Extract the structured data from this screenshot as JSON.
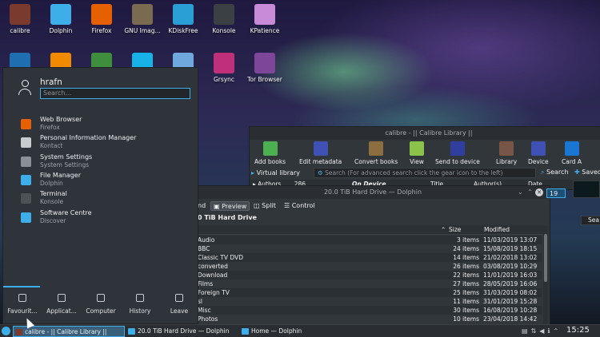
{
  "desktop_icons_row1": [
    {
      "label": "calibre",
      "icon": "calibre-icon",
      "color": "#7a3b2e"
    },
    {
      "label": "Dolphin",
      "icon": "folder-icon",
      "color": "#3daee9"
    },
    {
      "label": "Firefox",
      "icon": "firefox-icon",
      "color": "#e66000"
    },
    {
      "label": "GNU Imag...",
      "icon": "gimp-icon",
      "color": "#7a6a4f"
    },
    {
      "label": "KDiskFree",
      "icon": "disk-icon",
      "color": "#2a9fd6"
    },
    {
      "label": "Konsole",
      "icon": "terminal-icon",
      "color": "#3b4045"
    },
    {
      "label": "KPatience",
      "icon": "cards-icon",
      "color": "#c78bd8"
    }
  ],
  "desktop_icons_row2": [
    {
      "label": "",
      "icon": "virtualbox-icon",
      "color": "#1f6fb0"
    },
    {
      "label": "",
      "icon": "vlc-icon",
      "color": "#f08a00"
    },
    {
      "label": "",
      "icon": "keepass-icon",
      "color": "#3e8e3e"
    },
    {
      "label": "",
      "icon": "kodi-icon",
      "color": "#17b2e7"
    },
    {
      "label": "",
      "icon": "drop-icon",
      "color": "#6fa8dc"
    },
    {
      "label": "Grsync",
      "icon": "grsync-icon",
      "color": "#c0307a"
    },
    {
      "label": "Tor Browser",
      "icon": "tor-icon",
      "color": "#7d4698"
    }
  ],
  "launcher": {
    "user": "hrafn",
    "search_placeholder": "Search...",
    "apps": [
      {
        "name": "Web Browser",
        "sub": "Firefox",
        "color": "#e66000",
        "icon": "firefox-icon"
      },
      {
        "name": "Personal Information Manager",
        "sub": "Kontact",
        "color": "#c9ccce",
        "icon": "kontact-icon"
      },
      {
        "name": "System Settings",
        "sub": "System Settings",
        "color": "#8a9096",
        "icon": "settings-icon"
      },
      {
        "name": "File Manager",
        "sub": "Dolphin",
        "color": "#3daee9",
        "icon": "folder-icon"
      },
      {
        "name": "Terminal",
        "sub": "Konsole",
        "color": "#4d5257",
        "icon": "terminal-icon"
      },
      {
        "name": "Software Centre",
        "sub": "Discover",
        "color": "#3daee9",
        "icon": "discover-icon"
      }
    ],
    "tabs": [
      {
        "label": "Favourit...",
        "icon": "bookmark-icon"
      },
      {
        "label": "Applicat...",
        "icon": "grid-icon"
      },
      {
        "label": "Computer",
        "icon": "computer-icon"
      },
      {
        "label": "History",
        "icon": "clock-icon"
      },
      {
        "label": "Leave",
        "icon": "leave-icon"
      }
    ]
  },
  "calibre": {
    "title": "calibre - || Calibre Library ||",
    "toolbar": [
      {
        "label": "Add books",
        "color": "#4caf50",
        "icon": "add-books-icon"
      },
      {
        "label": "Edit metadata",
        "color": "#3f51b5",
        "icon": "edit-metadata-icon"
      },
      {
        "label": "Convert books",
        "color": "#8d6e3f",
        "icon": "convert-books-icon"
      },
      {
        "label": "View",
        "color": "#8bc34a",
        "icon": "view-icon"
      },
      {
        "label": "Send to device",
        "color": "#303f9f",
        "icon": "send-device-icon"
      },
      {
        "label": "Library",
        "color": "#795548",
        "icon": "library-icon"
      },
      {
        "label": "Device",
        "color": "#3f51b5",
        "icon": "device-icon"
      },
      {
        "label": "Card A",
        "color": "#1976d2",
        "icon": "card-icon"
      }
    ],
    "virtual_library": "Virtual library",
    "search_placeholder": "Search (For advanced search click the gear icon to the left)",
    "search_button": "Search",
    "saved_button": "Saved",
    "authors_label": "Authors",
    "authors_count": "286",
    "columns": [
      "On Device",
      "Title",
      "Author(s)",
      "Date"
    ],
    "side_badge": "19",
    "right_search_partial": "Sea"
  },
  "dolphin": {
    "title": "20.0 TiB Hard Drive — Dolphin",
    "toolbar_partial": "nd",
    "preview": "Preview",
    "split": "Split",
    "control": "Control",
    "location": "0 TiB Hard Drive",
    "columns": [
      "Size",
      "Modified"
    ],
    "rows": [
      {
        "name": "Audio",
        "size": "3 items",
        "modified": "11/03/2019 13:07"
      },
      {
        "name": "BBC",
        "size": "24 items",
        "modified": "15/08/2019 18:15"
      },
      {
        "name": "Classic TV DVD",
        "size": "14 items",
        "modified": "21/02/2018 13:02"
      },
      {
        "name": "converted",
        "size": "26 items",
        "modified": "03/08/2019 10:29"
      },
      {
        "name": "Download",
        "size": "22 items",
        "modified": "11/01/2019 16:03"
      },
      {
        "name": "Films",
        "size": "27 items",
        "modified": "28/05/2019 16:06"
      },
      {
        "name": "Foreign TV",
        "size": "25 items",
        "modified": "31/03/2019 08:02"
      },
      {
        "name": "sl",
        "size": "11 items",
        "modified": "31/01/2019 15:28"
      },
      {
        "name": "Misc",
        "size": "30 items",
        "modified": "16/08/2019 10:28"
      },
      {
        "name": "Photos",
        "size": "10 items",
        "modified": "23/04/2018 14:42"
      }
    ]
  },
  "taskbar": {
    "tasks": [
      {
        "label": "calibre - || Calibre Library ||",
        "icon": "calibre-icon",
        "color": "#7a3b2e"
      },
      {
        "label": "20.0 TiB Hard Drive — Dolphin",
        "icon": "folder-icon",
        "color": "#3daee9"
      },
      {
        "label": "Home — Dolphin",
        "icon": "folder-icon",
        "color": "#3daee9"
      }
    ],
    "clock": "15:25"
  }
}
